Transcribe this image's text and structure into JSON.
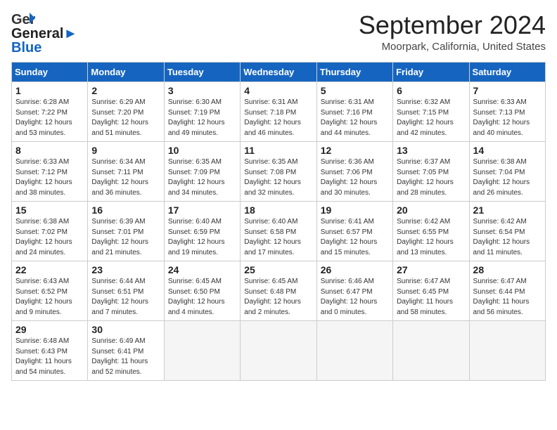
{
  "header": {
    "logo_line1": "General",
    "logo_line2": "Blue",
    "month_title": "September 2024",
    "location": "Moorpark, California, United States"
  },
  "weekdays": [
    "Sunday",
    "Monday",
    "Tuesday",
    "Wednesday",
    "Thursday",
    "Friday",
    "Saturday"
  ],
  "weeks": [
    [
      {
        "day": "1",
        "info": "Sunrise: 6:28 AM\nSunset: 7:22 PM\nDaylight: 12 hours\nand 53 minutes."
      },
      {
        "day": "2",
        "info": "Sunrise: 6:29 AM\nSunset: 7:20 PM\nDaylight: 12 hours\nand 51 minutes."
      },
      {
        "day": "3",
        "info": "Sunrise: 6:30 AM\nSunset: 7:19 PM\nDaylight: 12 hours\nand 49 minutes."
      },
      {
        "day": "4",
        "info": "Sunrise: 6:31 AM\nSunset: 7:18 PM\nDaylight: 12 hours\nand 46 minutes."
      },
      {
        "day": "5",
        "info": "Sunrise: 6:31 AM\nSunset: 7:16 PM\nDaylight: 12 hours\nand 44 minutes."
      },
      {
        "day": "6",
        "info": "Sunrise: 6:32 AM\nSunset: 7:15 PM\nDaylight: 12 hours\nand 42 minutes."
      },
      {
        "day": "7",
        "info": "Sunrise: 6:33 AM\nSunset: 7:13 PM\nDaylight: 12 hours\nand 40 minutes."
      }
    ],
    [
      {
        "day": "8",
        "info": "Sunrise: 6:33 AM\nSunset: 7:12 PM\nDaylight: 12 hours\nand 38 minutes."
      },
      {
        "day": "9",
        "info": "Sunrise: 6:34 AM\nSunset: 7:11 PM\nDaylight: 12 hours\nand 36 minutes."
      },
      {
        "day": "10",
        "info": "Sunrise: 6:35 AM\nSunset: 7:09 PM\nDaylight: 12 hours\nand 34 minutes."
      },
      {
        "day": "11",
        "info": "Sunrise: 6:35 AM\nSunset: 7:08 PM\nDaylight: 12 hours\nand 32 minutes."
      },
      {
        "day": "12",
        "info": "Sunrise: 6:36 AM\nSunset: 7:06 PM\nDaylight: 12 hours\nand 30 minutes."
      },
      {
        "day": "13",
        "info": "Sunrise: 6:37 AM\nSunset: 7:05 PM\nDaylight: 12 hours\nand 28 minutes."
      },
      {
        "day": "14",
        "info": "Sunrise: 6:38 AM\nSunset: 7:04 PM\nDaylight: 12 hours\nand 26 minutes."
      }
    ],
    [
      {
        "day": "15",
        "info": "Sunrise: 6:38 AM\nSunset: 7:02 PM\nDaylight: 12 hours\nand 24 minutes."
      },
      {
        "day": "16",
        "info": "Sunrise: 6:39 AM\nSunset: 7:01 PM\nDaylight: 12 hours\nand 21 minutes."
      },
      {
        "day": "17",
        "info": "Sunrise: 6:40 AM\nSunset: 6:59 PM\nDaylight: 12 hours\nand 19 minutes."
      },
      {
        "day": "18",
        "info": "Sunrise: 6:40 AM\nSunset: 6:58 PM\nDaylight: 12 hours\nand 17 minutes."
      },
      {
        "day": "19",
        "info": "Sunrise: 6:41 AM\nSunset: 6:57 PM\nDaylight: 12 hours\nand 15 minutes."
      },
      {
        "day": "20",
        "info": "Sunrise: 6:42 AM\nSunset: 6:55 PM\nDaylight: 12 hours\nand 13 minutes."
      },
      {
        "day": "21",
        "info": "Sunrise: 6:42 AM\nSunset: 6:54 PM\nDaylight: 12 hours\nand 11 minutes."
      }
    ],
    [
      {
        "day": "22",
        "info": "Sunrise: 6:43 AM\nSunset: 6:52 PM\nDaylight: 12 hours\nand 9 minutes."
      },
      {
        "day": "23",
        "info": "Sunrise: 6:44 AM\nSunset: 6:51 PM\nDaylight: 12 hours\nand 7 minutes."
      },
      {
        "day": "24",
        "info": "Sunrise: 6:45 AM\nSunset: 6:50 PM\nDaylight: 12 hours\nand 4 minutes."
      },
      {
        "day": "25",
        "info": "Sunrise: 6:45 AM\nSunset: 6:48 PM\nDaylight: 12 hours\nand 2 minutes."
      },
      {
        "day": "26",
        "info": "Sunrise: 6:46 AM\nSunset: 6:47 PM\nDaylight: 12 hours\nand 0 minutes."
      },
      {
        "day": "27",
        "info": "Sunrise: 6:47 AM\nSunset: 6:45 PM\nDaylight: 11 hours\nand 58 minutes."
      },
      {
        "day": "28",
        "info": "Sunrise: 6:47 AM\nSunset: 6:44 PM\nDaylight: 11 hours\nand 56 minutes."
      }
    ],
    [
      {
        "day": "29",
        "info": "Sunrise: 6:48 AM\nSunset: 6:43 PM\nDaylight: 11 hours\nand 54 minutes."
      },
      {
        "day": "30",
        "info": "Sunrise: 6:49 AM\nSunset: 6:41 PM\nDaylight: 11 hours\nand 52 minutes."
      },
      {
        "day": "",
        "info": ""
      },
      {
        "day": "",
        "info": ""
      },
      {
        "day": "",
        "info": ""
      },
      {
        "day": "",
        "info": ""
      },
      {
        "day": "",
        "info": ""
      }
    ]
  ]
}
